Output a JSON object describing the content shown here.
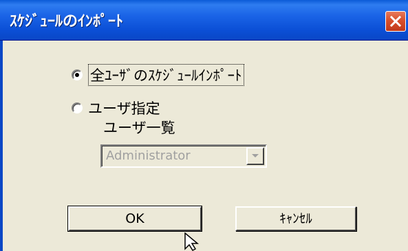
{
  "window": {
    "title": "ｽｹｼﾞｭｰﾙのｲﾝﾎﾟｰﾄ",
    "close_icon": "close-icon"
  },
  "options": {
    "all_users_label": "全ﾕｰｻﾞのｽｹｼﾞｭｰﾙｲﾝﾎﾟｰﾄ",
    "all_users_checked": true,
    "user_specified_label": "ユーザ指定",
    "user_specified_checked": false
  },
  "user_list": {
    "label": "ユーザ一覧",
    "selected_value": "Administrator",
    "disabled": true
  },
  "buttons": {
    "ok_label": "OK",
    "cancel_label": "ｷｬﾝｾﾙ"
  },
  "colors": {
    "titlebar": "#0b4fd6",
    "close_button": "#d8502c",
    "dialog_bg": "#ece9d8"
  }
}
